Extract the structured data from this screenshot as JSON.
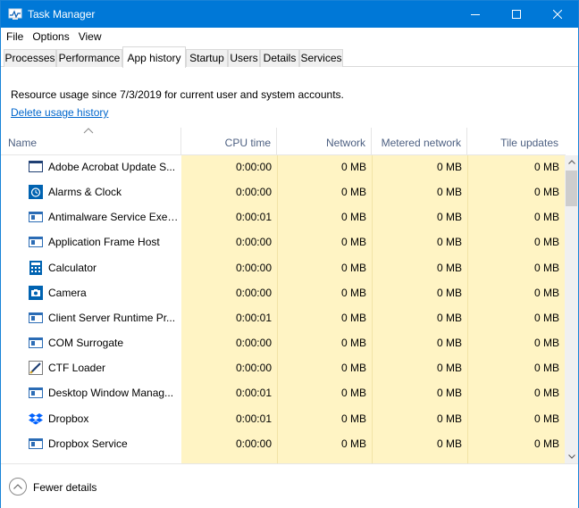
{
  "window": {
    "title": "Task Manager",
    "accent_color": "#0078d7"
  },
  "menu": {
    "items": [
      "File",
      "Options",
      "View"
    ]
  },
  "tabs": [
    {
      "label": "Processes",
      "active": false
    },
    {
      "label": "Performance",
      "active": false
    },
    {
      "label": "App history",
      "active": true
    },
    {
      "label": "Startup",
      "active": false
    },
    {
      "label": "Users",
      "active": false
    },
    {
      "label": "Details",
      "active": false
    },
    {
      "label": "Services",
      "active": false
    }
  ],
  "usage": {
    "text": "Resource usage since 7/3/2019 for current user and system accounts.",
    "delete_link": "Delete usage history"
  },
  "table": {
    "columns": {
      "name": "Name",
      "cpu": "CPU time",
      "network": "Network",
      "metered": "Metered network",
      "tile": "Tile updates"
    },
    "sort_indicator": "sort-ascending-arrow",
    "heat_color": "#fff4c4",
    "rows": [
      {
        "name": "Adobe Acrobat Update S...",
        "icon": "window-frame-icon",
        "cpu": "0:00:00",
        "network": "0 MB",
        "metered": "0 MB",
        "tile": "0 MB"
      },
      {
        "name": "Alarms & Clock",
        "icon": "alarm-clock-icon",
        "cpu": "0:00:00",
        "network": "0 MB",
        "metered": "0 MB",
        "tile": "0 MB"
      },
      {
        "name": "Antimalware Service Exec...",
        "icon": "app-window-icon",
        "cpu": "0:00:01",
        "network": "0 MB",
        "metered": "0 MB",
        "tile": "0 MB"
      },
      {
        "name": "Application Frame Host",
        "icon": "app-window-icon",
        "cpu": "0:00:00",
        "network": "0 MB",
        "metered": "0 MB",
        "tile": "0 MB"
      },
      {
        "name": "Calculator",
        "icon": "calculator-icon",
        "cpu": "0:00:00",
        "network": "0 MB",
        "metered": "0 MB",
        "tile": "0 MB"
      },
      {
        "name": "Camera",
        "icon": "camera-icon",
        "cpu": "0:00:00",
        "network": "0 MB",
        "metered": "0 MB",
        "tile": "0 MB"
      },
      {
        "name": "Client Server Runtime Pr...",
        "icon": "app-window-icon",
        "cpu": "0:00:01",
        "network": "0 MB",
        "metered": "0 MB",
        "tile": "0 MB"
      },
      {
        "name": "COM Surrogate",
        "icon": "app-window-icon",
        "cpu": "0:00:00",
        "network": "0 MB",
        "metered": "0 MB",
        "tile": "0 MB"
      },
      {
        "name": "CTF Loader",
        "icon": "pen-icon",
        "cpu": "0:00:00",
        "network": "0 MB",
        "metered": "0 MB",
        "tile": "0 MB"
      },
      {
        "name": "Desktop Window Manag...",
        "icon": "app-window-icon",
        "cpu": "0:00:01",
        "network": "0 MB",
        "metered": "0 MB",
        "tile": "0 MB"
      },
      {
        "name": "Dropbox",
        "icon": "dropbox-icon",
        "cpu": "0:00:01",
        "network": "0 MB",
        "metered": "0 MB",
        "tile": "0 MB"
      },
      {
        "name": "Dropbox Service",
        "icon": "app-window-icon",
        "cpu": "0:00:00",
        "network": "0 MB",
        "metered": "0 MB",
        "tile": "0 MB"
      }
    ]
  },
  "footer": {
    "fewer_details": "Fewer details"
  }
}
